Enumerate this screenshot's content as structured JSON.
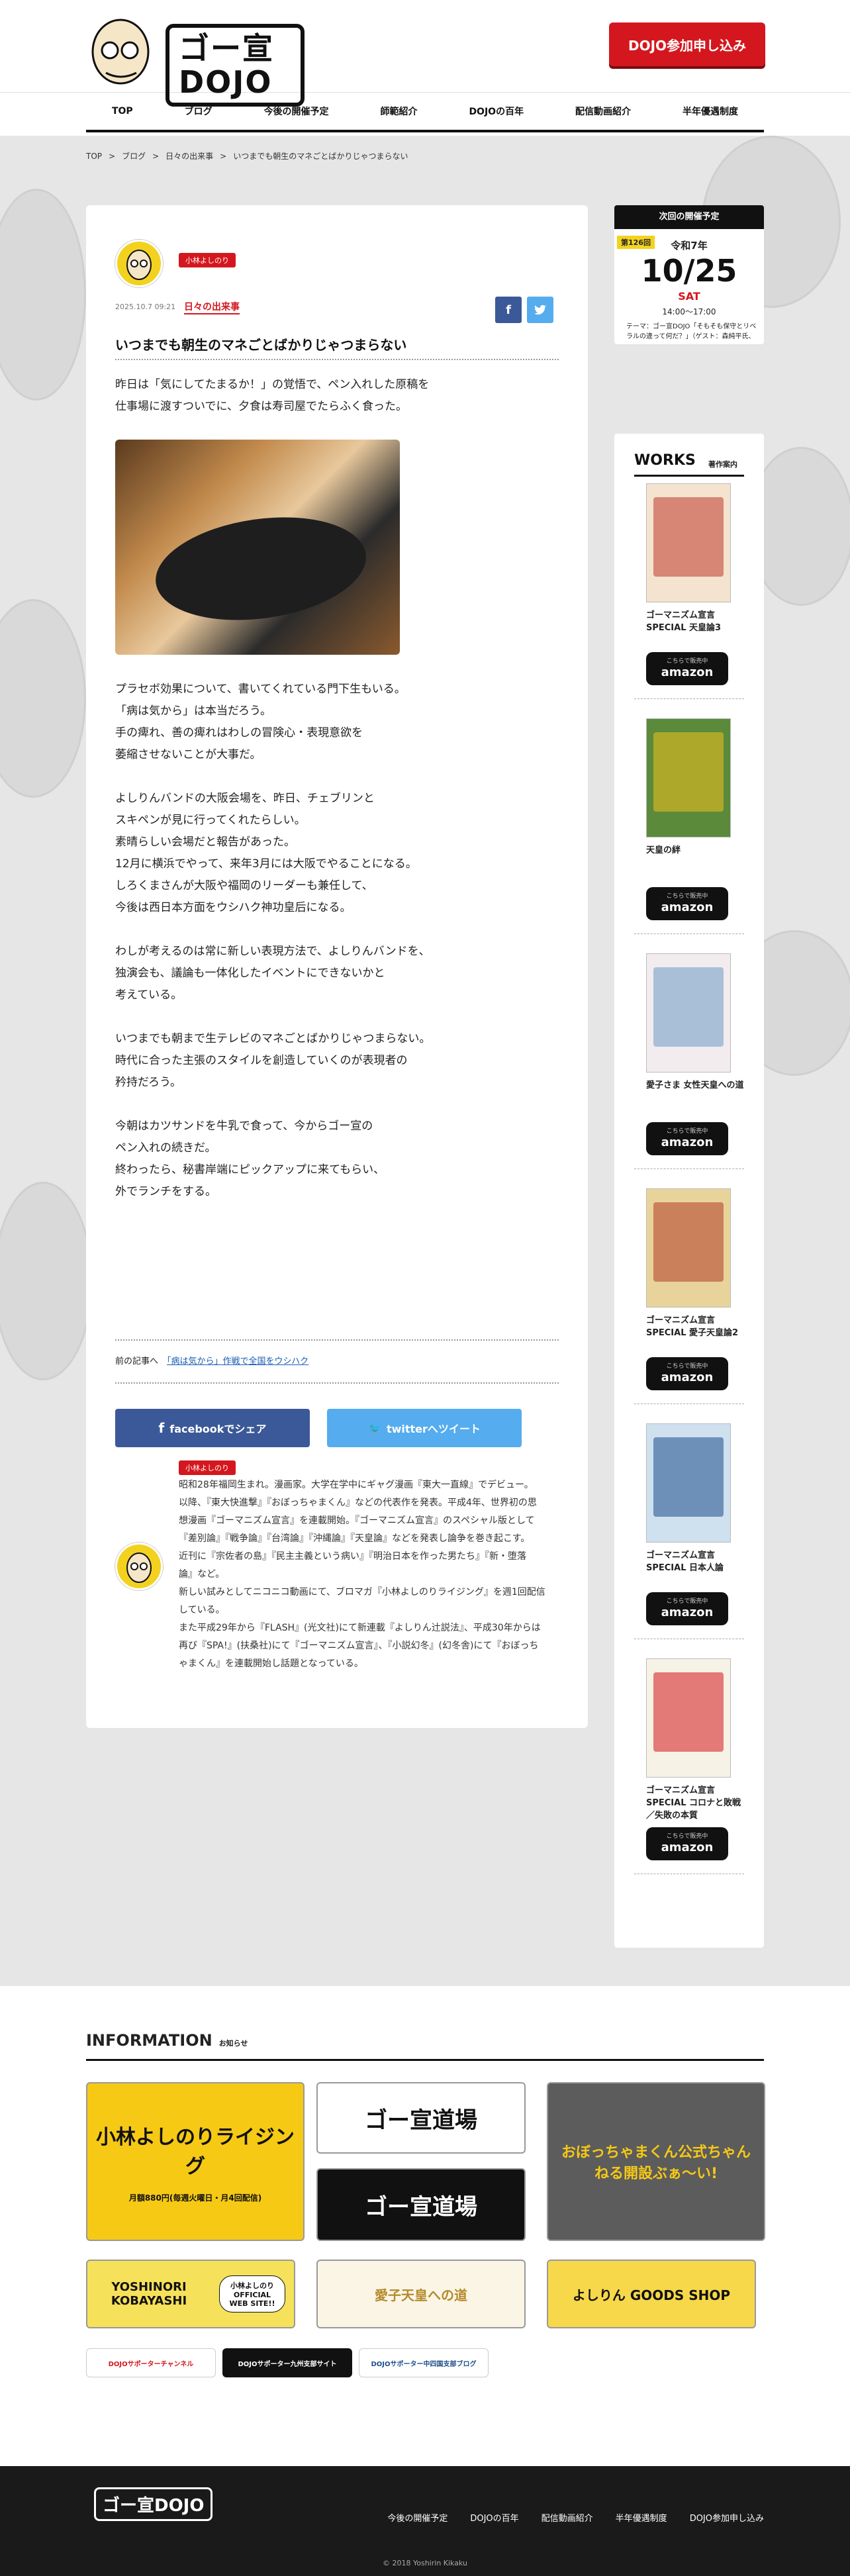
{
  "header": {
    "logo": "ゴー宣DOJO",
    "cta": "DOJO参加申し込み"
  },
  "nav": [
    "TOP",
    "ブログ",
    "今後の開催予定",
    "師範紹介",
    "DOJOの百年",
    "配信動画紹介",
    "半年優遇制度"
  ],
  "breadcrumb": [
    "TOP",
    ">",
    "ブログ",
    ">",
    "日々の出来事",
    ">",
    "いつまでも朝生のマネごとばかりじゃつまらない"
  ],
  "article": {
    "author": "小林よしのり",
    "date": "2025.10.7 09:21",
    "category": "日々の出来事",
    "title": "いつまでも朝生のマネごとばかりじゃつまらない",
    "paragraphs": [
      [
        "昨日は「気にしてたまるか！」の覚悟で、ペン入れした原稿を",
        "仕事場に渡すついでに、夕食は寿司屋でたらふく食った。"
      ],
      [
        "プラセボ効果について、書いてくれている門下生もいる。",
        "「病は気から」は本当だろう。",
        "手の痺れ、善の痺れはわしの冒険心・表現意欲を",
        "萎縮させないことが大事だ。"
      ],
      [
        "よしりんバンドの大阪会場を、昨日、チェブリンと",
        "スキペンが見に行ってくれたらしい。",
        "素晴らしい会場だと報告があった。",
        "12月に横浜でやって、来年3月には大阪でやることになる。",
        "しろくまさんが大阪や福岡のリーダーも兼任して、",
        "今後は西日本方面をウシハク神功皇后になる。"
      ],
      [
        "わしが考えるのは常に新しい表現方法で、よしりんバンドを、",
        "独演会も、議論も一体化したイベントにできないかと",
        "考えている。"
      ],
      [
        "いつまでも朝まで生テレビのマネごとばかりじゃつまらない。",
        "時代に合った主張のスタイルを創造していくのが表現者の",
        "矜持だろう。"
      ],
      [
        "今朝はカツサンドを牛乳で食って、今からゴー宣の",
        "ペン入れの続きだ。",
        "終わったら、秘書岸端にピックアップに来てもらい、",
        "外でランチをする。"
      ]
    ],
    "prev_label": "前の記事へ",
    "prev_link": "「病は気から」作戦で全国をウシハク",
    "share_fb": "facebookでシェア",
    "share_tw": "twitterへツイート",
    "bio_author": "小林よしのり",
    "bio": [
      "昭和28年福岡生まれ。漫画家。大学在学中にギャグ漫画『東大一直線』でデビュー。",
      "以降、『東大快進撃』『おぼっちゃまくん』などの代表作を発表。平成4年、世界初の思",
      "想漫画『ゴーマニズム宣言』を連載開始。『ゴーマニズム宣言』のスペシャル版として",
      "『差別論』『戦争論』『台湾論』『沖縄論』『天皇論』などを発表し論争を巻き起こす。",
      "近刊に『宗佐者の島』『民主主義という病い』『明治日本を作った男たち』『新・堕落",
      "論』など。",
      "新しい試みとしてニコニコ動画にて、ブロマガ『小林よしのりライジング』を週1回配信",
      "している。",
      "また平成29年から『FLASH』(光文社)にて新連載『よしりん辻説法』、平成30年からは",
      "再び『SPA!』(扶桑社)にて『ゴーマニズム宣言』、『小説幻冬』(幻冬舎)にて『おぼっち",
      "ゃまくん』を連載開始し話題となっている。"
    ]
  },
  "next_event": {
    "head": "次回の開催予定",
    "episode": "第126回",
    "era": "令和7年",
    "date": "10/25",
    "day": "SAT",
    "time": "14:00〜17:00",
    "theme": "テーマ：ゴー宣DOJO「そもそも保守とリベラルの違って何だ？」（ゲスト：森純平氏、中島岳志氏、山尾志桜里氏）"
  },
  "works": {
    "title": "WORKS",
    "sub": "著作案内",
    "amazon_small": "こちらで販売中",
    "amazon": "amazon",
    "items": [
      {
        "title": "ゴーマニズム宣言SPECIAL 天皇論3",
        "cover": "#f4e3cf",
        "accent": "#c0392b"
      },
      {
        "title": "天皇の絆",
        "cover": "#5a8a3a",
        "accent": "#f2c01e"
      },
      {
        "title": "愛子さま 女性天皇への道",
        "cover": "#f2ecef",
        "accent": "#6d9bc3"
      },
      {
        "title": "ゴーマニズム宣言SPECIAL 愛子天皇論2",
        "cover": "#e8d49a",
        "accent": "#b23a2a"
      },
      {
        "title": "ゴーマニズム宣言SPECIAL 日本人論",
        "cover": "#cfe0ef",
        "accent": "#1e4f8a"
      },
      {
        "title": "ゴーマニズム宣言SPECIAL コロナと敗戦／失敗の本質",
        "cover": "#f7f2e6",
        "accent": "#d4171e"
      }
    ]
  },
  "info": {
    "title": "INFORMATION",
    "sub": "お知らせ",
    "banners": [
      "小林よしのりライジング",
      "月額880円(毎週火曜日・月4回配信)",
      "ゴー宣道場",
      "ゴー宣道場",
      "おぼっちゃまくん公式ちゃんねる開設ぶぁ〜い!",
      "YOSHINORI KOBAYASHI",
      "小林よしのり OFFICIAL WEB SITE!!",
      "愛子天皇への道",
      "よしりん GOODS SHOP"
    ],
    "small": [
      "DOJOサポーターチャンネル",
      "DOJOサポーター九州支部サイト",
      "DOJOサポーター中四国支部ブログ"
    ]
  },
  "footer": {
    "logo": "ゴー宣DOJO",
    "nav": [
      "今後の開催予定",
      "DOJOの百年",
      "配信動画紹介",
      "半年優遇制度",
      "DOJO参加申し込み"
    ],
    "copy": "© 2018 Yoshirin Kikaku"
  },
  "colors": {
    "accent": "#d4171e",
    "facebook": "#3b5998",
    "twitter": "#55acee",
    "dark": "#111111"
  }
}
